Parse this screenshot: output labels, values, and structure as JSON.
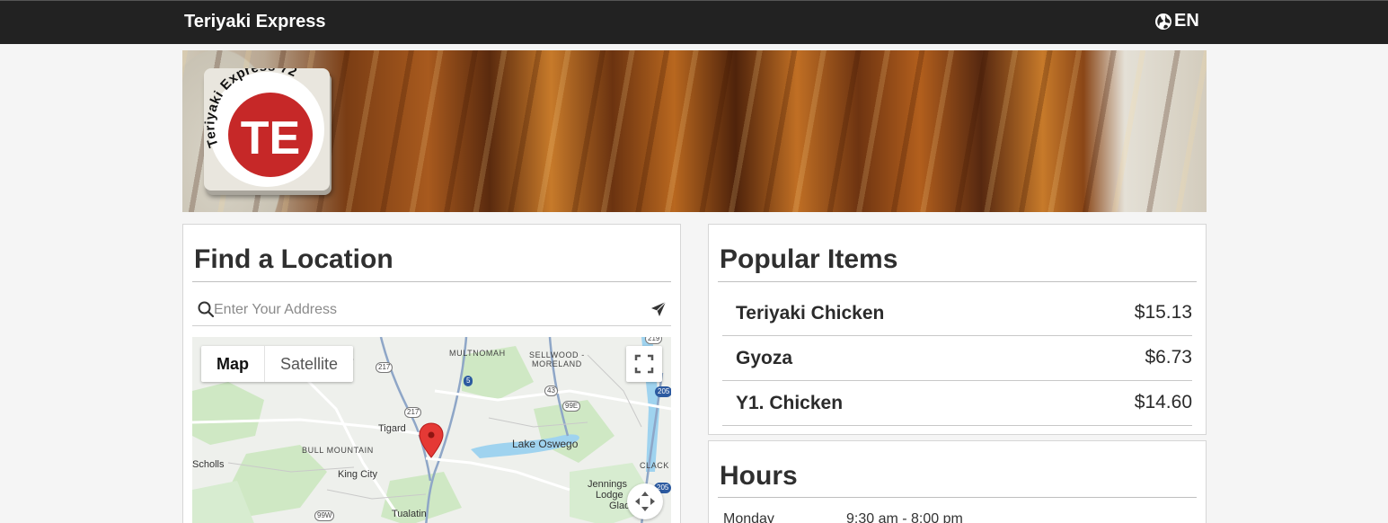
{
  "header": {
    "brand": "Teriyaki Express",
    "language": "EN",
    "language_icon": "globe-icon"
  },
  "hero": {
    "logo_text_top": "Teriyaki Express 72",
    "logo_initials": "TE",
    "logo_color": "#c62828"
  },
  "location": {
    "title": "Find a Location",
    "search_placeholder": "Enter Your Address",
    "search_value": "",
    "map": {
      "map_tab": "Map",
      "satellite_tab": "Satellite",
      "active_tab": "Map",
      "labels": {
        "multnomah": "MULTNOMAH",
        "sellwood": "SELLWOOD -",
        "moreland": "MORELAND",
        "tigard": "Tigard",
        "bull_mountain": "BULL MOUNTAIN",
        "lake_oswego": "Lake Oswego",
        "scholls": "Scholls",
        "king_city": "King City",
        "clack": "CLACK",
        "jennings": "Jennings",
        "lodge": "Lodge",
        "gladstone": "Gladst",
        "tualatin": "Tualatin"
      },
      "shields": {
        "s217a": "217",
        "s217b": "217",
        "s5": "5",
        "s43": "43",
        "s99e": "99E",
        "s205a": "205",
        "s205b": "205",
        "s99w": "99W",
        "s219": "219"
      }
    }
  },
  "popular": {
    "title": "Popular Items",
    "items": [
      {
        "name": "Teriyaki Chicken",
        "price": "$15.13"
      },
      {
        "name": "Gyoza",
        "price": "$6.73"
      },
      {
        "name": "Y1. Chicken",
        "price": "$14.60"
      }
    ]
  },
  "hours": {
    "title": "Hours",
    "rows": [
      {
        "day": "Monday",
        "time": "9:30 am - 8:00 pm"
      }
    ]
  }
}
